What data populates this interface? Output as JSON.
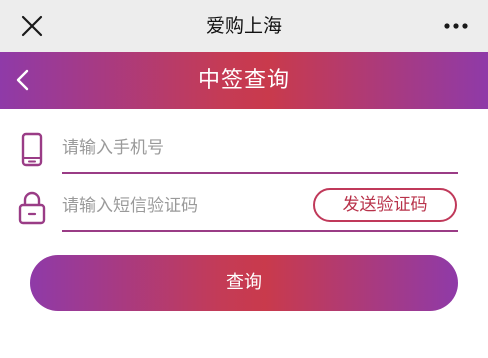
{
  "topbar": {
    "title": "爱购上海",
    "close_icon": "close-icon",
    "more_icon": "more-horizontal-icon"
  },
  "header": {
    "title": "中签查询",
    "back_icon": "chevron-left-icon"
  },
  "form": {
    "phone": {
      "icon": "phone-icon",
      "placeholder": "请输入手机号",
      "value": ""
    },
    "code": {
      "icon": "lock-icon",
      "placeholder": "请输入短信验证码",
      "value": "",
      "send_label": "发送验证码"
    },
    "submit_label": "查询"
  },
  "colors": {
    "gradient_purple": "#8f3aa8",
    "gradient_red": "#c43b56",
    "accent": "#c0395a"
  }
}
